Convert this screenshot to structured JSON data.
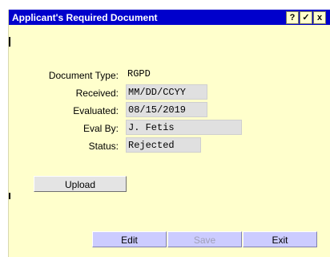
{
  "window": {
    "title": "Applicant's Required Document",
    "help_label": "?",
    "ok_label": "✓",
    "close_label": "x"
  },
  "form": {
    "document_type": {
      "label": "Document Type:",
      "value": "RGPD"
    },
    "received": {
      "label": "Received:",
      "value": "MM/DD/CCYY"
    },
    "evaluated": {
      "label": "Evaluated:",
      "value": "08/15/2019"
    },
    "eval_by": {
      "label": "Eval By:",
      "value": "J. Fetis"
    },
    "status": {
      "label": "Status:",
      "value": "Rejected"
    }
  },
  "buttons": {
    "upload": "Upload",
    "edit": "Edit",
    "save": "Save",
    "exit": "Exit"
  }
}
